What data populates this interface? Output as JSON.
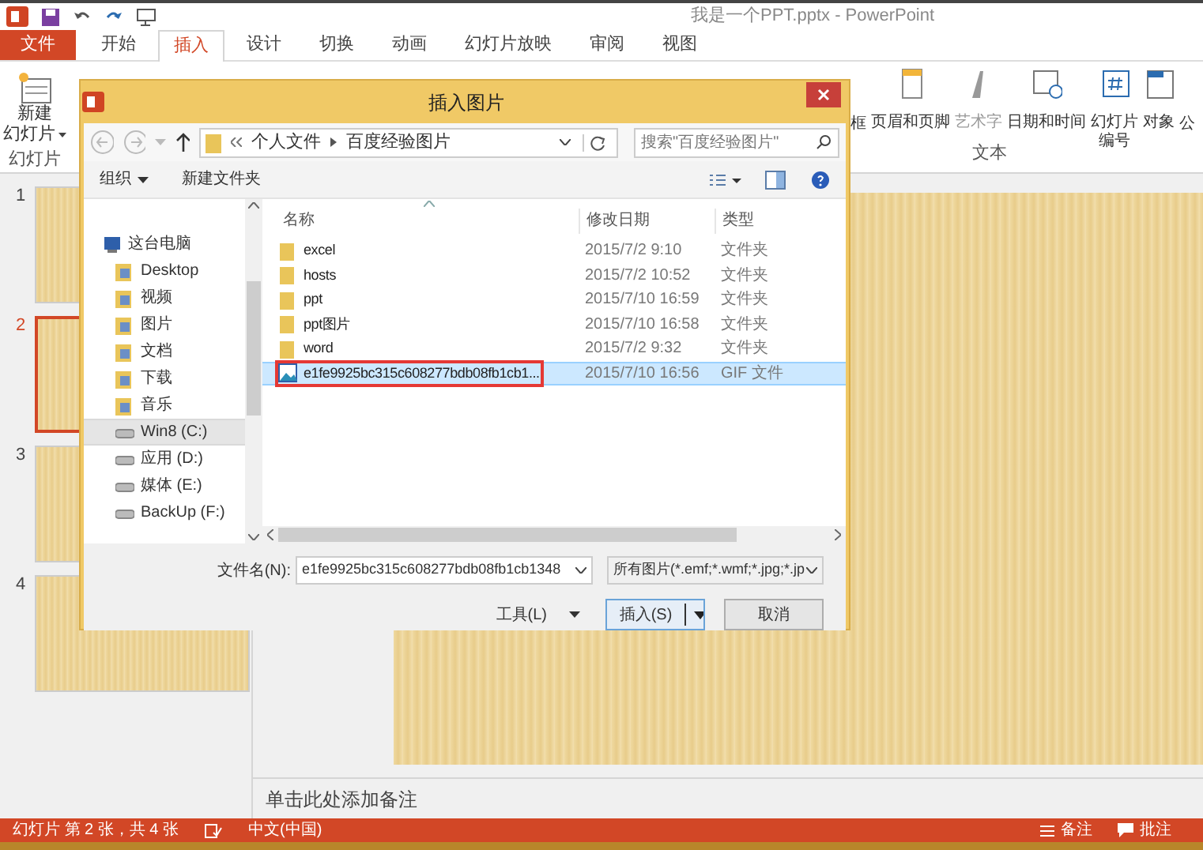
{
  "window": {
    "title": "我是一个PPT.pptx - PowerPoint"
  },
  "tabs": [
    {
      "label": "文件",
      "kind": "file",
      "selected": false
    },
    {
      "label": "开始",
      "kind": "tab",
      "selected": false
    },
    {
      "label": "插入",
      "kind": "tab",
      "selected": true
    },
    {
      "label": "设计",
      "kind": "tab",
      "selected": false
    },
    {
      "label": "切换",
      "kind": "tab",
      "selected": false
    },
    {
      "label": "动画",
      "kind": "tab",
      "selected": false
    },
    {
      "label": "幻灯片放映",
      "kind": "tab",
      "selected": false
    },
    {
      "label": "审阅",
      "kind": "tab",
      "selected": false
    },
    {
      "label": "视图",
      "kind": "tab",
      "selected": false
    }
  ],
  "ribbon": {
    "slides_group": {
      "button": [
        "新建",
        "幻灯片"
      ],
      "group_label": "幻灯片"
    },
    "text_group": {
      "buttons": [
        {
          "label": "框",
          "disabled": false
        },
        {
          "label": "页眉和页脚",
          "disabled": false
        },
        {
          "label": "艺术字",
          "disabled": true
        },
        {
          "label": "日期和时间",
          "disabled": false
        },
        {
          "label": "幻灯片编号",
          "disabled": false
        },
        {
          "label": "对象",
          "disabled": false
        },
        {
          "label": "公",
          "disabled": false
        }
      ],
      "group_label": "文本"
    }
  },
  "slides": [
    {
      "number": "1",
      "selected": false
    },
    {
      "number": "2",
      "selected": true
    },
    {
      "number": "3",
      "selected": false
    },
    {
      "number": "4",
      "selected": false
    }
  ],
  "notes": {
    "placeholder": "单击此处添加备注"
  },
  "status_bar": {
    "slide_info": "幻灯片 第 2 张，共 4 张",
    "language": "中文(中国)",
    "notes": "备注",
    "comments": "批注"
  },
  "dialog": {
    "title": "插入图片",
    "breadcrumb": [
      "个人文件",
      "百度经验图片"
    ],
    "search": {
      "placeholder": "搜索\"百度经验图片\""
    },
    "toolbar": {
      "organize": "组织",
      "new_folder": "新建文件夹"
    },
    "nav": [
      {
        "label": "这台电脑",
        "kind": "pc",
        "selected": false,
        "children": [
          {
            "label": "Desktop",
            "kind": "folder",
            "selected": false
          },
          {
            "label": "视频",
            "kind": "folder",
            "selected": false
          },
          {
            "label": "图片",
            "kind": "folder",
            "selected": false
          },
          {
            "label": "文档",
            "kind": "folder",
            "selected": false
          },
          {
            "label": "下载",
            "kind": "folder",
            "selected": false
          },
          {
            "label": "音乐",
            "kind": "folder",
            "selected": false
          },
          {
            "label": "Win8 (C:)",
            "kind": "drive",
            "selected": true
          },
          {
            "label": "应用 (D:)",
            "kind": "drive",
            "selected": false
          },
          {
            "label": "媒体 (E:)",
            "kind": "drive",
            "selected": false
          },
          {
            "label": "BackUp (F:)",
            "kind": "drive",
            "selected": false
          }
        ]
      }
    ],
    "columns": [
      "名称",
      "修改日期",
      "类型"
    ],
    "rows": [
      {
        "name": "excel",
        "date": "2015/7/2 9:10",
        "type": "文件夹",
        "kind": "folder",
        "selected": false,
        "highlighted": false
      },
      {
        "name": "hosts",
        "date": "2015/7/2 10:52",
        "type": "文件夹",
        "kind": "folder",
        "selected": false,
        "highlighted": false
      },
      {
        "name": "ppt",
        "date": "2015/7/10 16:59",
        "type": "文件夹",
        "kind": "folder",
        "selected": false,
        "highlighted": false
      },
      {
        "name": "ppt图片",
        "date": "2015/7/10 16:58",
        "type": "文件夹",
        "kind": "folder",
        "selected": false,
        "highlighted": false
      },
      {
        "name": "word",
        "date": "2015/7/2 9:32",
        "type": "文件夹",
        "kind": "folder",
        "selected": false,
        "highlighted": false
      },
      {
        "name": "e1fe9925bc315c608277bdb08fb1cb1...",
        "date": "2015/7/10 16:56",
        "type": "GIF 文件",
        "kind": "image",
        "selected": true,
        "highlighted": true
      }
    ],
    "filename": {
      "label": "文件名(N):",
      "value": "e1fe9925bc315c608277bdb08fb1cb1348"
    },
    "filetype": {
      "value": "所有图片(*.emf;*.wmf;*.jpg;*.jp"
    },
    "tools": "工具(L)",
    "insert": "插入(S)",
    "cancel": "取消"
  }
}
